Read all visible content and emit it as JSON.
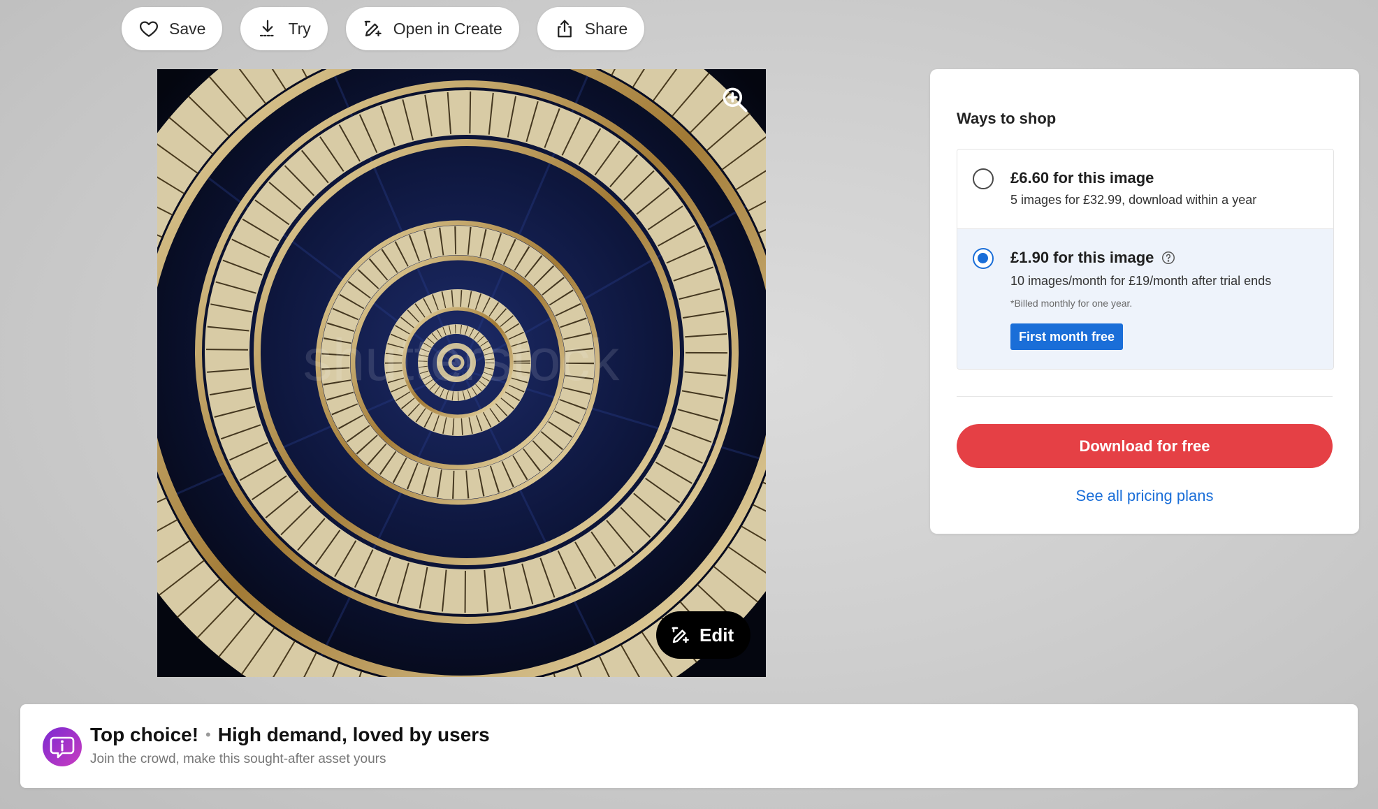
{
  "toolbar": {
    "save_label": "Save",
    "try_label": "Try",
    "open_create_label": "Open in Create",
    "share_label": "Share"
  },
  "image": {
    "watermark": "shutterstock",
    "edit_label": "Edit"
  },
  "shop": {
    "title": "Ways to shop",
    "options": [
      {
        "price": "£6.60 for this image",
        "description": "5 images for £32.99, download within a year",
        "selected": false
      },
      {
        "price": "£1.90 for this image",
        "description": "10 images/month for £19/month after trial ends",
        "note": "*Billed monthly for one year.",
        "badge": "First month free",
        "selected": true
      }
    ],
    "download_label": "Download for free",
    "pricing_link": "See all pricing plans"
  },
  "banner": {
    "title_lead": "Top choice!",
    "separator": "•",
    "title_rest": "High demand, loved by users",
    "subtitle": "Join the crowd, make this sought-after asset yours"
  },
  "colors": {
    "accent_blue": "#1a6ed8",
    "download_red": "#e54045",
    "banner_icon_purple": "#a23ac8"
  }
}
